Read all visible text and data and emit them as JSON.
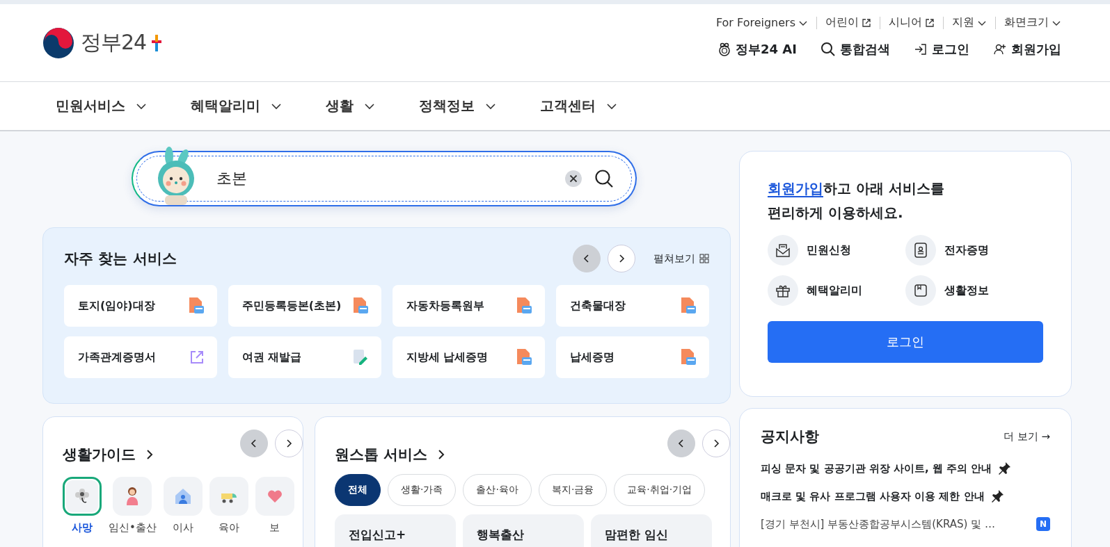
{
  "logo": {
    "text": "정부24"
  },
  "top_links": [
    {
      "label": "For Foreigners",
      "kind": "dropdown"
    },
    {
      "label": "어린이",
      "kind": "external"
    },
    {
      "label": "시니어",
      "kind": "external"
    },
    {
      "label": "지원",
      "kind": "dropdown"
    },
    {
      "label": "화면크기",
      "kind": "dropdown"
    }
  ],
  "actions": [
    {
      "label": "정부24 AI",
      "kind": "ai"
    },
    {
      "label": "통합검색",
      "kind": "search"
    },
    {
      "label": "로그인",
      "kind": "login"
    },
    {
      "label": "회원가입",
      "kind": "signup"
    }
  ],
  "nav": [
    "민원서비스",
    "혜택알리미",
    "생활",
    "정책정보",
    "고객센터"
  ],
  "search": {
    "value": "초본"
  },
  "frequent": {
    "title": "자주 찾는 서비스",
    "expand_label": "펼쳐보기",
    "services": [
      {
        "label": "토지(임야)대장",
        "kind": "pdf"
      },
      {
        "label": "주민등록등본(초본)",
        "kind": "pdf"
      },
      {
        "label": "자동차등록원부",
        "kind": "pdf"
      },
      {
        "label": "건축물대장",
        "kind": "pdf"
      },
      {
        "label": "가족관계증명서",
        "kind": "external"
      },
      {
        "label": "여권 재발급",
        "kind": "edit"
      },
      {
        "label": "지방세 납세증명",
        "kind": "pdf"
      },
      {
        "label": "납세증명",
        "kind": "pdf"
      }
    ]
  },
  "signup_card": {
    "link": "회원가입",
    "line_1": "하고 아래 서비스를",
    "line_2": "편리하게 이용하세요.",
    "features": [
      {
        "label": "민원신청",
        "kind": "mail"
      },
      {
        "label": "전자증명",
        "kind": "id"
      },
      {
        "label": "혜택알리미",
        "kind": "gift"
      },
      {
        "label": "생활정보",
        "kind": "book"
      }
    ],
    "button": "로그인"
  },
  "life_guide": {
    "title": "생활가이드",
    "items": [
      {
        "label": "사망",
        "kind": "flower",
        "selected": true
      },
      {
        "label": "임신•출산",
        "kind": "pregnant",
        "selected": false
      },
      {
        "label": "이사",
        "kind": "house",
        "selected": false
      },
      {
        "label": "육아",
        "kind": "stroller",
        "selected": false
      },
      {
        "label": "보",
        "kind": "health",
        "selected": false
      }
    ]
  },
  "onestop": {
    "title": "원스톱 서비스",
    "filters": [
      {
        "label": "전체",
        "selected": true
      },
      {
        "label": "생활·가족",
        "selected": false
      },
      {
        "label": "출산·육아",
        "selected": false
      },
      {
        "label": "복지·금융",
        "selected": false
      },
      {
        "label": "교육·취업·기업",
        "selected": false
      }
    ],
    "cards": [
      "전입신고+",
      "행복출산",
      "맘편한 임신"
    ]
  },
  "notices": {
    "title": "공지사항",
    "more": "더 보기 →",
    "items": [
      {
        "text": "피싱 문자 및 공공기관 위장 사이트, 웹 주의 안내",
        "pinned": true
      },
      {
        "text": "매크로 및 유사 프로그램 사용자 이용 제한 안내",
        "pinned": true
      },
      {
        "text": "[경기 부천시] 부동산종합공부시스템(KRAS) 및 …",
        "pinned": false,
        "badge": "N"
      }
    ]
  }
}
